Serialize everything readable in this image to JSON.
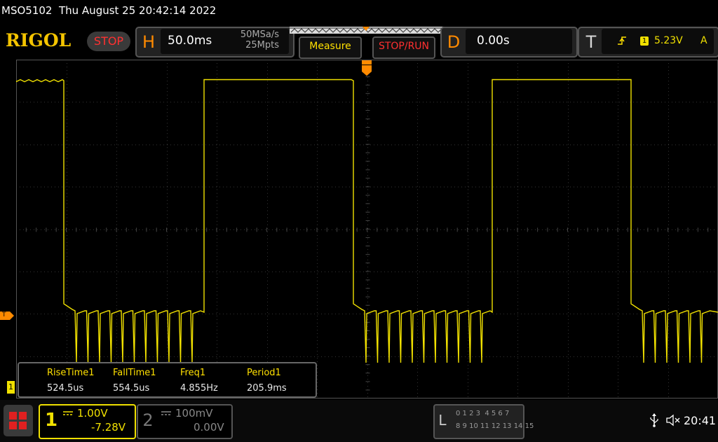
{
  "header": {
    "title": "MSO5102  Thu August 25 20:42:14 2022",
    "logo": "RIGOL",
    "status": "STOP"
  },
  "horizontal": {
    "letter": "H",
    "timebase": "50.0ms",
    "sample_rate": "50MSa/s",
    "memory_depth": "25Mpts"
  },
  "buttons": {
    "measure": "Measure",
    "stop_run": "STOP/RUN"
  },
  "delay": {
    "letter": "D",
    "value": "0.00s"
  },
  "trigger": {
    "letter": "T",
    "source": "1",
    "level": "5.23V",
    "mode": "A",
    "marker": "T"
  },
  "measurements": {
    "headers": [
      "RiseTime1",
      "FallTime1",
      "Freq1",
      "Period1"
    ],
    "values": [
      "524.5us",
      "554.5us",
      "4.855Hz",
      "205.9ms"
    ]
  },
  "channel1": {
    "number": "1",
    "scale": "1.00V",
    "offset": "-7.28V",
    "color": "#f0e000"
  },
  "channel2": {
    "number": "2",
    "scale": "100mV",
    "offset": "0.00V"
  },
  "logic": {
    "letter": "L",
    "row1": "0 1 2 3  4 5 6 7",
    "row2": "8 9 10 11 12 13 14 15"
  },
  "status_bar": {
    "time": "20:41",
    "icons": [
      "usb-icon",
      "speaker-muted-icon"
    ]
  }
}
